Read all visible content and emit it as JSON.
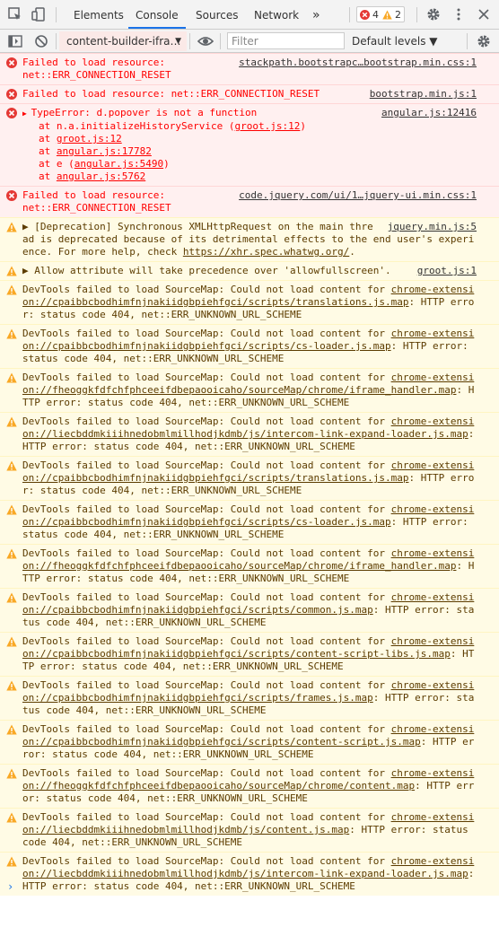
{
  "topbar": {
    "tabs": [
      {
        "label": "Elements"
      },
      {
        "label": "Console"
      },
      {
        "label": "Sources"
      },
      {
        "label": "Network"
      }
    ],
    "more": "»",
    "error_count": "4",
    "warning_count": "2"
  },
  "toolbar": {
    "context": "content-builder-ifra…",
    "context_arrow": "▼",
    "filter_placeholder": "Filter",
    "levels": "Default levels ▼"
  },
  "messages": [
    {
      "type": "error",
      "text": "Failed to load resource:\nnet::ERR_CONNECTION_RESET",
      "source": "stackpath.bootstrapc…bootstrap.min.css:1"
    },
    {
      "type": "error",
      "text": "Failed to load resource: net::ERR_CONNECTION_RESET",
      "source": "bootstrap.min.js:1"
    },
    {
      "type": "error",
      "head": "TypeError: d.popover is not a function",
      "source": "angular.js:12416",
      "stack": [
        {
          "pre": "at n.a.initializeHistoryService (",
          "link": "groot.js:12",
          "post": ")"
        },
        {
          "pre": "at ",
          "link": "groot.js:12",
          "post": ""
        },
        {
          "pre": "at ",
          "link": "angular.js:17782",
          "post": ""
        },
        {
          "pre": "at e (",
          "link": "angular.js:5490",
          "post": ")"
        },
        {
          "pre": "at ",
          "link": "angular.js:5762",
          "post": ""
        }
      ]
    },
    {
      "type": "error",
      "text": "Failed to load resource:\nnet::ERR_CONNECTION_RESET",
      "source": "code.jquery.com/ui/1…jquery-ui.min.css:1"
    },
    {
      "type": "warn",
      "pre": "▶ [Deprecation] Synchronous XMLHttpRequest on the main thread is deprecated because of its detrimental effects to the end user's experience. For more help, check ",
      "link": "https://xhr.spec.whatwg.org/",
      "post": ".",
      "source": "jquery.min.js:5"
    },
    {
      "type": "warn",
      "pre": "▶ Allow attribute will take precedence over 'allowfullscreen'.",
      "source": "groot.js:1"
    },
    {
      "type": "warn",
      "pre": "DevTools failed to load SourceMap: Could not load content for ",
      "link": "chrome-extension://cpaibbcbodhimfnjnakiidgbpiehfgci/scripts/translations.js.map",
      "post": ": HTTP error: status code 404, net::ERR_UNKNOWN_URL_SCHEME"
    },
    {
      "type": "warn",
      "pre": "DevTools failed to load SourceMap: Could not load content for ",
      "link": "chrome-extension://cpaibbcbodhimfnjnakiidgbpiehfgci/scripts/cs-loader.js.map",
      "post": ": HTTP error: status code 404, net::ERR_UNKNOWN_URL_SCHEME"
    },
    {
      "type": "warn",
      "pre": "DevTools failed to load SourceMap: Could not load content for ",
      "link": "chrome-extension://fheoggkfdfchfphceeifdbepaooicaho/sourceMap/chrome/iframe_handler.map",
      "post": ": HTTP error: status code 404, net::ERR_UNKNOWN_URL_SCHEME"
    },
    {
      "type": "warn",
      "pre": "DevTools failed to load SourceMap: Could not load content for ",
      "link": "chrome-extension://liecbddmkiiihnedobmlmillhodjkdmb/js/intercom-link-expand-loader.js.map",
      "post": ": HTTP error: status code 404, net::ERR_UNKNOWN_URL_SCHEME"
    },
    {
      "type": "warn",
      "pre": "DevTools failed to load SourceMap: Could not load content for ",
      "link": "chrome-extension://cpaibbcbodhimfnjnakiidgbpiehfgci/scripts/translations.js.map",
      "post": ": HTTP error: status code 404, net::ERR_UNKNOWN_URL_SCHEME"
    },
    {
      "type": "warn",
      "pre": "DevTools failed to load SourceMap: Could not load content for ",
      "link": "chrome-extension://cpaibbcbodhimfnjnakiidgbpiehfgci/scripts/cs-loader.js.map",
      "post": ": HTTP error: status code 404, net::ERR_UNKNOWN_URL_SCHEME"
    },
    {
      "type": "warn",
      "pre": "DevTools failed to load SourceMap: Could not load content for ",
      "link": "chrome-extension://fheoggkfdfchfphceeifdbepaooicaho/sourceMap/chrome/iframe_handler.map",
      "post": ": HTTP error: status code 404, net::ERR_UNKNOWN_URL_SCHEME"
    },
    {
      "type": "warn",
      "pre": "DevTools failed to load SourceMap: Could not load content for ",
      "link": "chrome-extension://cpaibbcbodhimfnjnakiidgbpiehfgci/scripts/common.js.map",
      "post": ": HTTP error: status code 404, net::ERR_UNKNOWN_URL_SCHEME"
    },
    {
      "type": "warn",
      "pre": "DevTools failed to load SourceMap: Could not load content for ",
      "link": "chrome-extension://cpaibbcbodhimfnjnakiidgbpiehfgci/scripts/content-script-libs.js.map",
      "post": ": HTTP error: status code 404, net::ERR_UNKNOWN_URL_SCHEME"
    },
    {
      "type": "warn",
      "pre": "DevTools failed to load SourceMap: Could not load content for ",
      "link": "chrome-extension://cpaibbcbodhimfnjnakiidgbpiehfgci/scripts/frames.js.map",
      "post": ": HTTP error: status code 404, net::ERR_UNKNOWN_URL_SCHEME"
    },
    {
      "type": "warn",
      "pre": "DevTools failed to load SourceMap: Could not load content for ",
      "link": "chrome-extension://cpaibbcbodhimfnjnakiidgbpiehfgci/scripts/content-script.js.map",
      "post": ": HTTP error: status code 404, net::ERR_UNKNOWN_URL_SCHEME"
    },
    {
      "type": "warn",
      "pre": "DevTools failed to load SourceMap: Could not load content for ",
      "link": "chrome-extension://fheoggkfdfchfphceeifdbepaooicaho/sourceMap/chrome/content.map",
      "post": ": HTTP error: status code 404, net::ERR_UNKNOWN_URL_SCHEME"
    },
    {
      "type": "warn",
      "pre": "DevTools failed to load SourceMap: Could not load content for ",
      "link": "chrome-extension://liecbddmkiiihnedobmlmillhodjkdmb/js/content.js.map",
      "post": ": HTTP error: status code 404, net::ERR_UNKNOWN_URL_SCHEME"
    },
    {
      "type": "warn",
      "pre": "DevTools failed to load SourceMap: Could not load content for ",
      "link": "chrome-extension://liecbddmkiiihnedobmlmillhodjkdmb/js/intercom-link-expand-loader.js.map",
      "post": ": HTTP error: status code 404, net::ERR_UNKNOWN_URL_SCHEME"
    }
  ],
  "prompt": "›"
}
